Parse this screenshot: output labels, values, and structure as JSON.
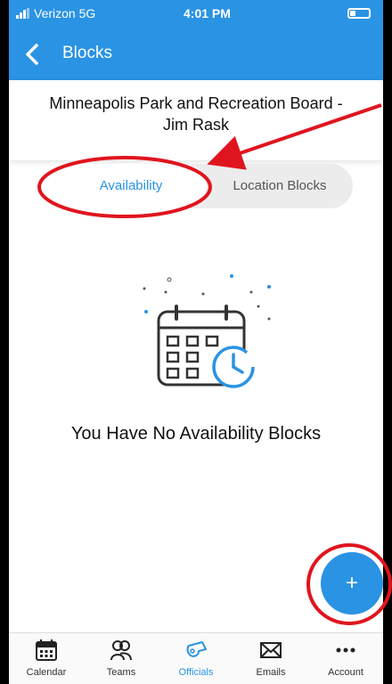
{
  "status_bar": {
    "carrier": "Verizon  5G",
    "time": "4:01 PM"
  },
  "nav": {
    "title": "Blocks"
  },
  "org": {
    "line1": "Minneapolis Park and Recreation Board -",
    "line2": "Jim Rask"
  },
  "tabs": [
    {
      "label": "Availability",
      "selected": true
    },
    {
      "label": "Location Blocks",
      "selected": false
    }
  ],
  "empty_state": {
    "message": "You Have No Availability Blocks",
    "icon": "calendar-clock-icon"
  },
  "fab": {
    "label": "+"
  },
  "tab_bar": [
    {
      "label": "Calendar",
      "icon": "calendar-icon"
    },
    {
      "label": "Teams",
      "icon": "teams-icon"
    },
    {
      "label": "Officials",
      "icon": "whistle-icon",
      "active": true
    },
    {
      "label": "Emails",
      "icon": "envelope-icon"
    },
    {
      "label": "Account",
      "icon": "more-icon"
    }
  ],
  "colors": {
    "accent": "#2a93e4",
    "annotation": "#e0141e"
  }
}
